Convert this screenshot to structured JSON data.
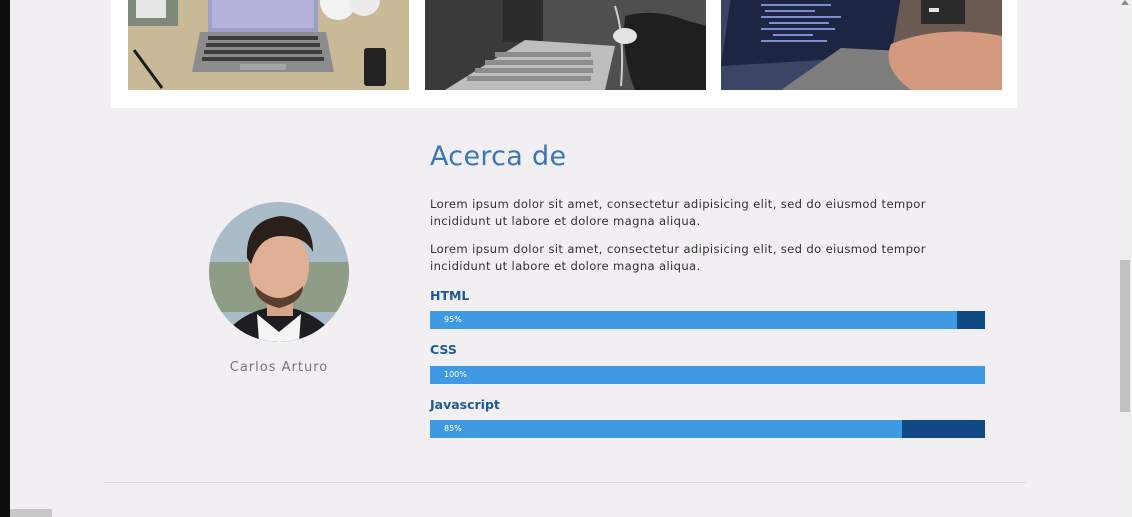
{
  "about": {
    "title": "Acerca de",
    "paragraphs": [
      "Lorem ipsum dolor sit amet, consectetur adipisicing elit, sed do eiusmod tempor incididunt ut labore et dolore magna aliqua.",
      "Lorem ipsum dolor sit amet, consectetur adipisicing elit, sed do eiusmod tempor incididunt ut labore et dolore magna aliqua."
    ]
  },
  "profile": {
    "name": "Carlos Arturo"
  },
  "skills": [
    {
      "name": "HTML",
      "label": "95%",
      "percent": 95
    },
    {
      "name": "CSS",
      "label": "100%",
      "percent": 100
    },
    {
      "name": "Javascript",
      "label": "85%",
      "percent": 85
    }
  ],
  "colors": {
    "accent": "#3b76b6",
    "bar_fill": "#3f9ae3",
    "bar_track": "#124a86",
    "background": "#f1eff1"
  },
  "gallery": {
    "images": [
      "laptop-desk-photo",
      "keyboard-mouse-photo",
      "coding-laptop-photo"
    ]
  }
}
